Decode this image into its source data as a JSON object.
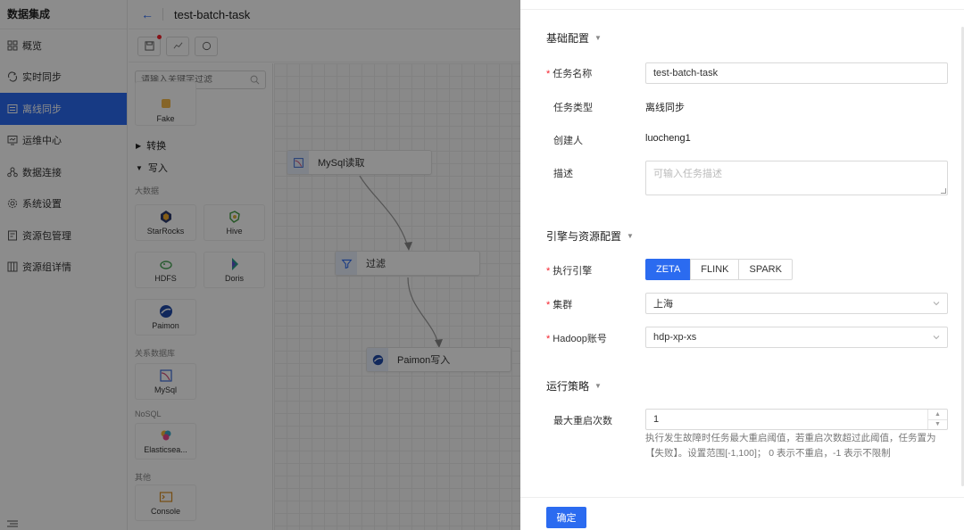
{
  "app": {
    "title": "数据集成"
  },
  "sidebar": {
    "items": [
      {
        "label": "概览",
        "icon": "grid-icon"
      },
      {
        "label": "实时同步",
        "icon": "sync-icon"
      },
      {
        "label": "离线同步",
        "icon": "list-icon",
        "active": true
      },
      {
        "label": "运维中心",
        "icon": "monitor-icon"
      },
      {
        "label": "数据连接",
        "icon": "connection-icon"
      },
      {
        "label": "系统设置",
        "icon": "gear-icon"
      },
      {
        "label": "资源包管理",
        "icon": "package-icon"
      },
      {
        "label": "资源组详情",
        "icon": "columns-icon"
      }
    ]
  },
  "header": {
    "back_icon": "←",
    "task_title": "test-batch-task"
  },
  "palette": {
    "search_placeholder": "请输入关键字过滤",
    "top_item": "Fake",
    "groups": {
      "transform": "转换",
      "write": "写入"
    },
    "categories": {
      "bigdata": "大数据",
      "relational": "关系数据库",
      "nosql": "NoSQL",
      "other": "其他"
    },
    "components": {
      "starrocks": "StarRocks",
      "hive": "Hive",
      "hdfs": "HDFS",
      "doris": "Doris",
      "paimon": "Paimon",
      "mysql": "MySql",
      "elasticsearch": "Elasticsea...",
      "console": "Console"
    }
  },
  "canvas": {
    "nodes": {
      "source": "MySql读取",
      "filter": "过滤",
      "sink": "Paimon写入"
    }
  },
  "drawer": {
    "basic": {
      "title": "基础配置",
      "task_name_label": "任务名称",
      "task_name_value": "test-batch-task",
      "task_type_label": "任务类型",
      "task_type_value": "离线同步",
      "creator_label": "创建人",
      "creator_value": "luocheng1",
      "desc_label": "描述",
      "desc_placeholder": "可输入任务描述"
    },
    "engine": {
      "title": "引擎与资源配置",
      "engine_label": "执行引擎",
      "engine_options": [
        "ZETA",
        "FLINK",
        "SPARK"
      ],
      "engine_selected": "ZETA",
      "cluster_label": "集群",
      "cluster_value": "上海",
      "hadoop_label": "Hadoop账号",
      "hadoop_value": "hdp-xp-xs"
    },
    "strategy": {
      "title": "运行策略",
      "retry_label": "最大重启次数",
      "retry_value": "1",
      "retry_help": "执行发生故障时任务最大重启阈值，若重启次数超过此阈值，任务置为【失败】。设置范围[-1,100]；  0 表示不重启，-1 表示不限制"
    },
    "confirm_label": "确定"
  },
  "colors": {
    "accent": "#2b6bf0",
    "required": "#f5222d"
  }
}
